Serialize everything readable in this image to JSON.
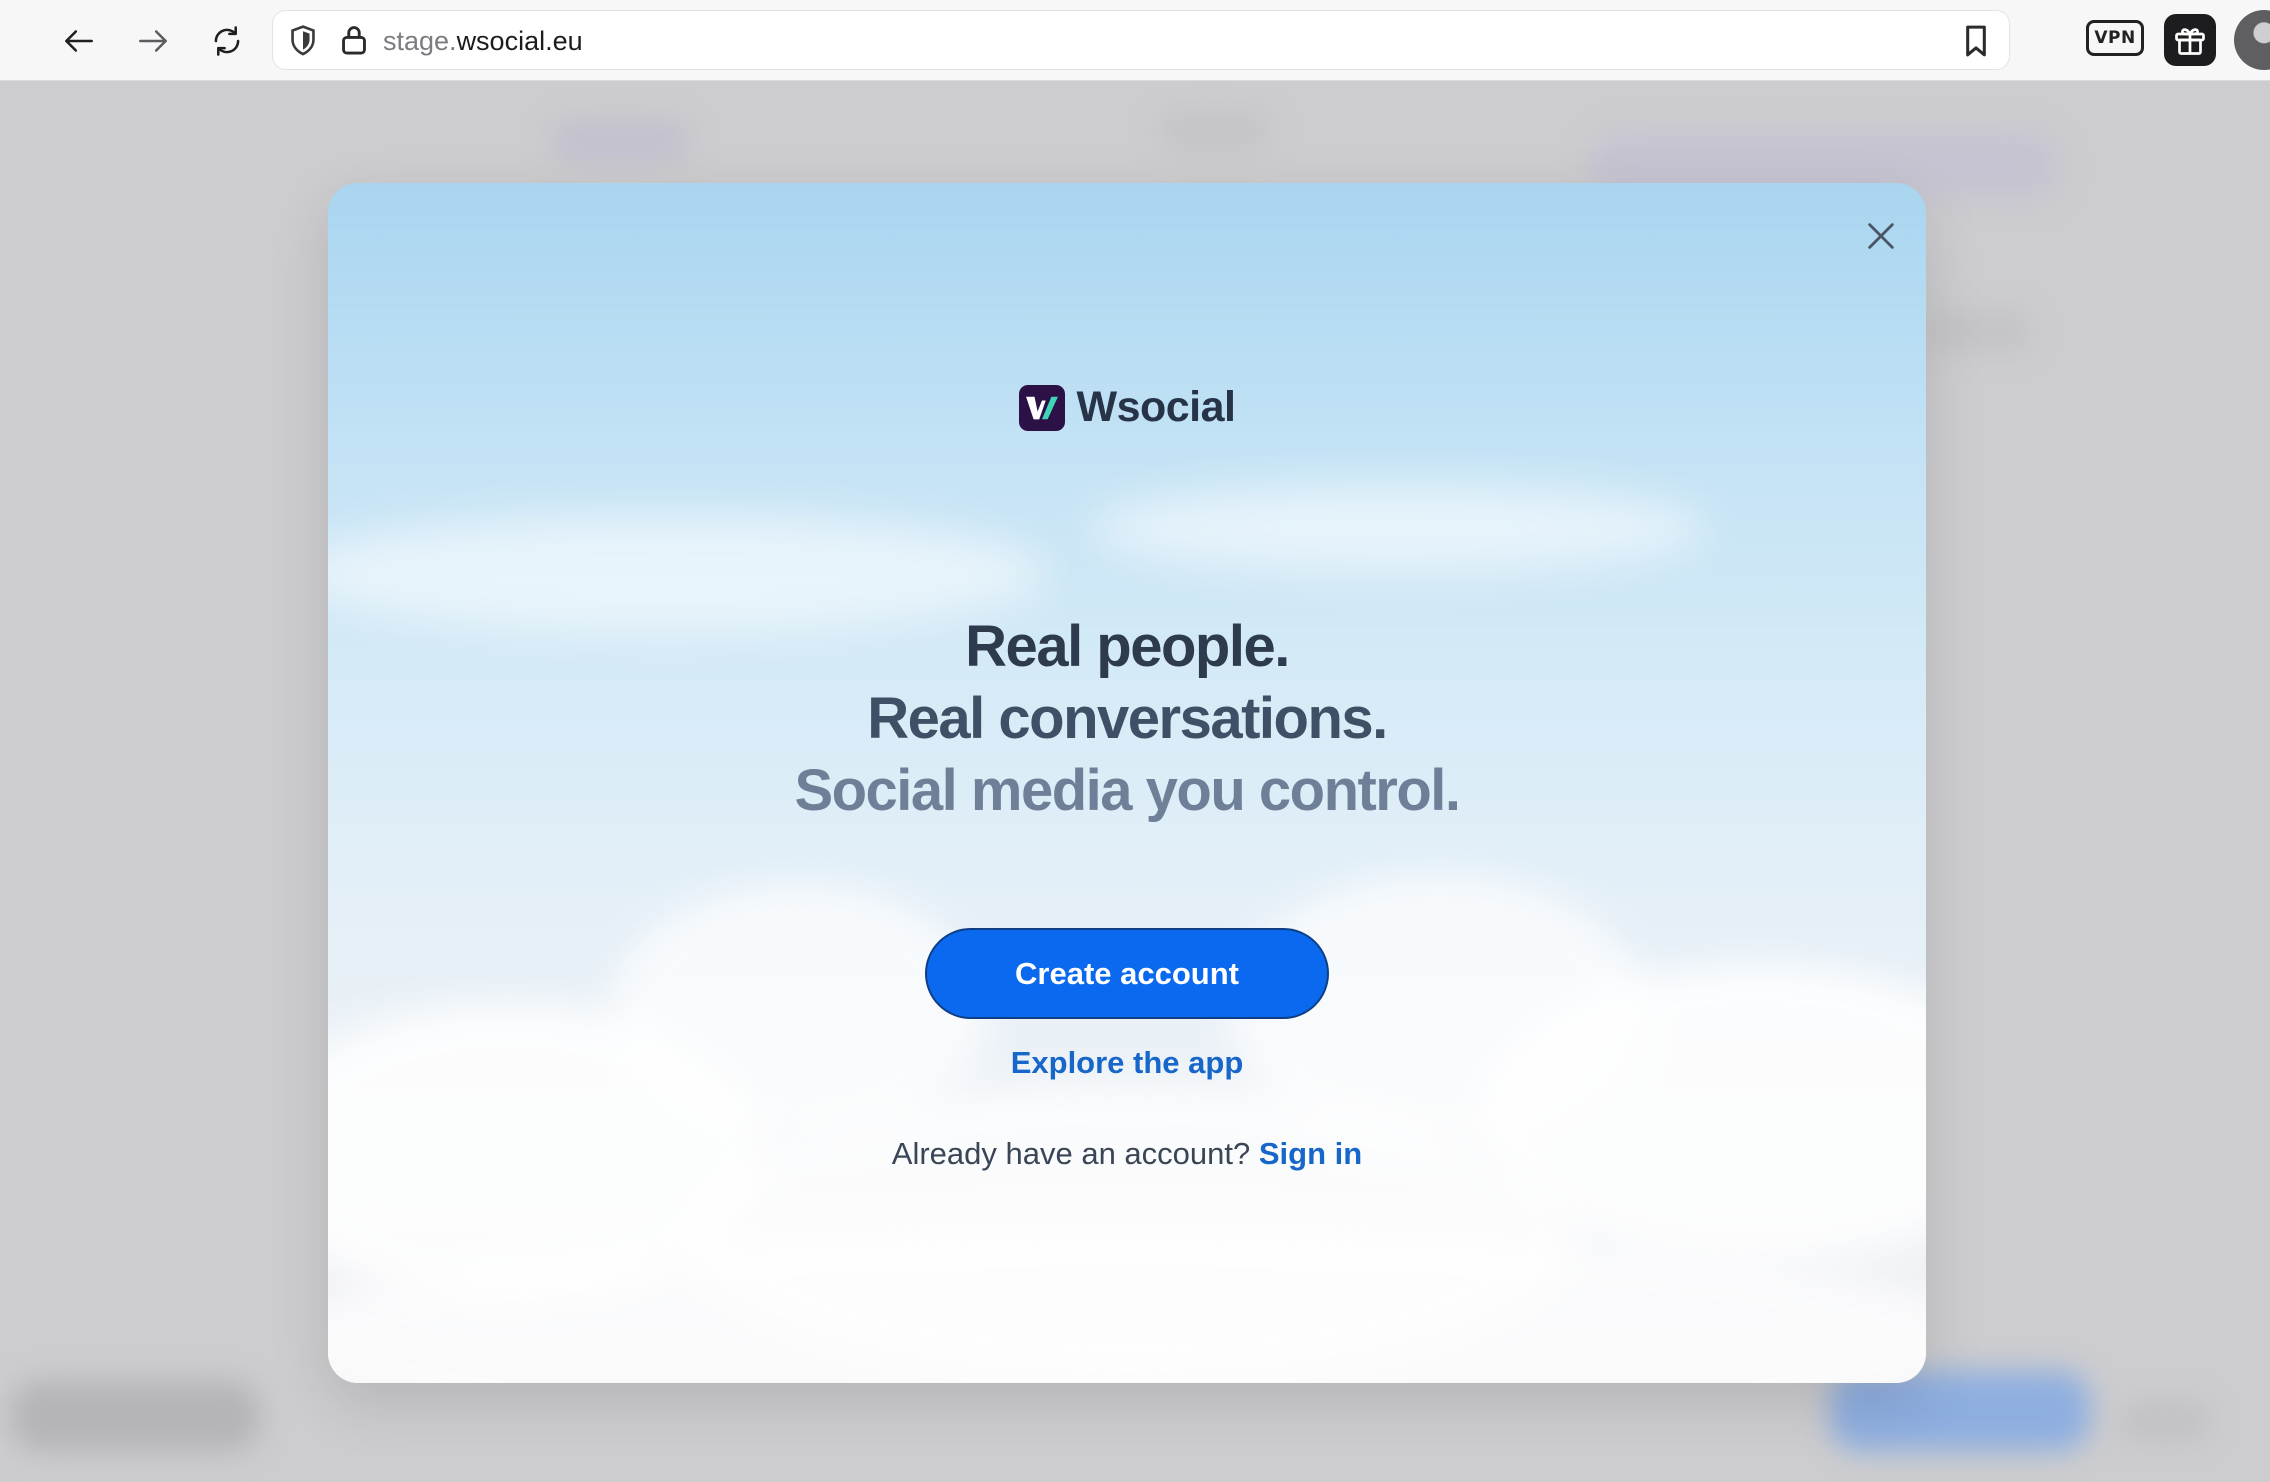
{
  "browser": {
    "url_subdomain": "stage.",
    "url_domain": "wsocial.eu",
    "vpn_label": "VPN"
  },
  "modal": {
    "brand_name": "Wsocial",
    "headline": {
      "line1": "Real people.",
      "line2": "Real conversations.",
      "line3": "Social media you control."
    },
    "create_account_label": "Create account",
    "explore_label": "Explore the app",
    "signin_prompt": "Already have an account?",
    "signin_label": "Sign in"
  },
  "icons": {
    "back": "back-arrow-icon",
    "forward": "forward-arrow-icon",
    "reload": "reload-icon",
    "shield": "shield-icon",
    "lock": "lock-icon",
    "bookmark": "bookmark-icon",
    "gift": "gift-icon",
    "close": "close-icon"
  },
  "colors": {
    "primary_button": "#0a69ef",
    "link": "#1766c9",
    "logo_bg": "#2c1146"
  }
}
